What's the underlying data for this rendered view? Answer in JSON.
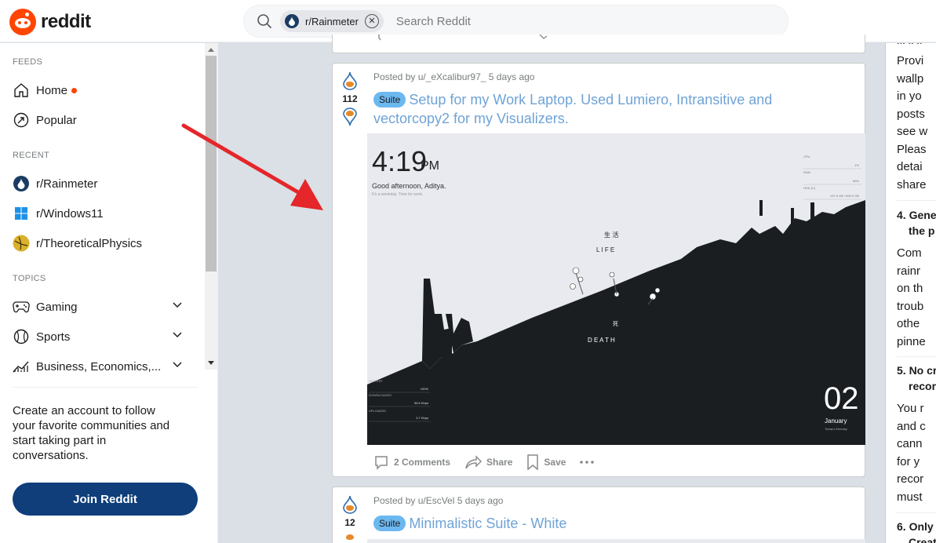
{
  "header": {
    "logo_text": "reddit",
    "search_chip": "r/Rainmeter",
    "search_placeholder": "Search Reddit"
  },
  "sidebar": {
    "feeds_label": "FEEDS",
    "feeds": [
      {
        "label": "Home",
        "icon": "home-icon",
        "has_dot": true
      },
      {
        "label": "Popular",
        "icon": "popular-icon"
      }
    ],
    "recent_label": "RECENT",
    "recent": [
      {
        "label": "r/Rainmeter",
        "icon": "rainmeter-icon"
      },
      {
        "label": "r/Windows11",
        "icon": "windows-icon"
      },
      {
        "label": "r/TheoreticalPhysics",
        "icon": "physics-icon"
      }
    ],
    "topics_label": "TOPICS",
    "topics": [
      {
        "label": "Gaming",
        "icon": "gamepad-icon"
      },
      {
        "label": "Sports",
        "icon": "baseball-icon"
      },
      {
        "label": "Business, Economics,...",
        "icon": "chart-icon"
      }
    ],
    "cta_text": "Create an account to follow your favorite communities and start taking part in conversations.",
    "join_label": "Join Reddit"
  },
  "posts": [
    {
      "votes": "112",
      "meta": "Posted by u/_eXcalibur97_ 5 days ago",
      "flair": "Suite",
      "title": "Setup for my Work Laptop. Used Lumiero, Intransitive and vectorcopy2 for my Visualizers.",
      "comments": "2 Comments",
      "share": "Share",
      "save": "Save",
      "image": {
        "time": "4:19",
        "ampm": "PM",
        "greeting": "Good afternoon, Aditya.",
        "subgreeting": "It's a weekday. Time for work.",
        "life_cn": "生 活",
        "life": "L I F E",
        "death_cn": "死",
        "death": "D E A T H",
        "day": "02",
        "month": "January",
        "weekday": "Today's Monday",
        "stats_top": [
          {
            "label": "CPU",
            "value": "1%"
          },
          {
            "label": "RAM",
            "value": "56%"
          },
          {
            "label": "HDD (C)",
            "value": "197.6 GB / 899.0 GB"
          }
        ],
        "stats_bottom": [
          {
            "label": "BATTERY",
            "value": "100%"
          },
          {
            "label": "DOWNLOADED",
            "value": "56.6 Kbps"
          },
          {
            "label": "UPLOADED",
            "value": "3.7 Kbps"
          }
        ]
      }
    },
    {
      "votes": "12",
      "meta": "Posted by u/EscVel 5 days ago",
      "flair": "Suite",
      "title": "Minimalistic Suite - White"
    }
  ],
  "rules": {
    "top_cut": "... .. ..",
    "r3_lines": [
      "Provi",
      "wallp",
      "in yo",
      "posts",
      "see w",
      "Pleas",
      "detai",
      "share"
    ],
    "r4_head": [
      "4. Gene",
      "the p"
    ],
    "r4_lines": [
      "Com",
      "rainr",
      "on th",
      "troub",
      "othe",
      "pinne"
    ],
    "r5_head": [
      "5. No cr",
      "recor"
    ],
    "r5_lines": [
      "You r",
      "and c",
      "cann",
      "for y",
      "recor",
      "must"
    ],
    "r6_head": [
      "6. Only",
      "Creat"
    ]
  },
  "colors": {
    "brand": "#ff4500",
    "join_button": "#0f3e7a",
    "title_link": "#6fa3d6",
    "flair": "#6cb8f0",
    "annotation_arrow": "#e5262a"
  }
}
